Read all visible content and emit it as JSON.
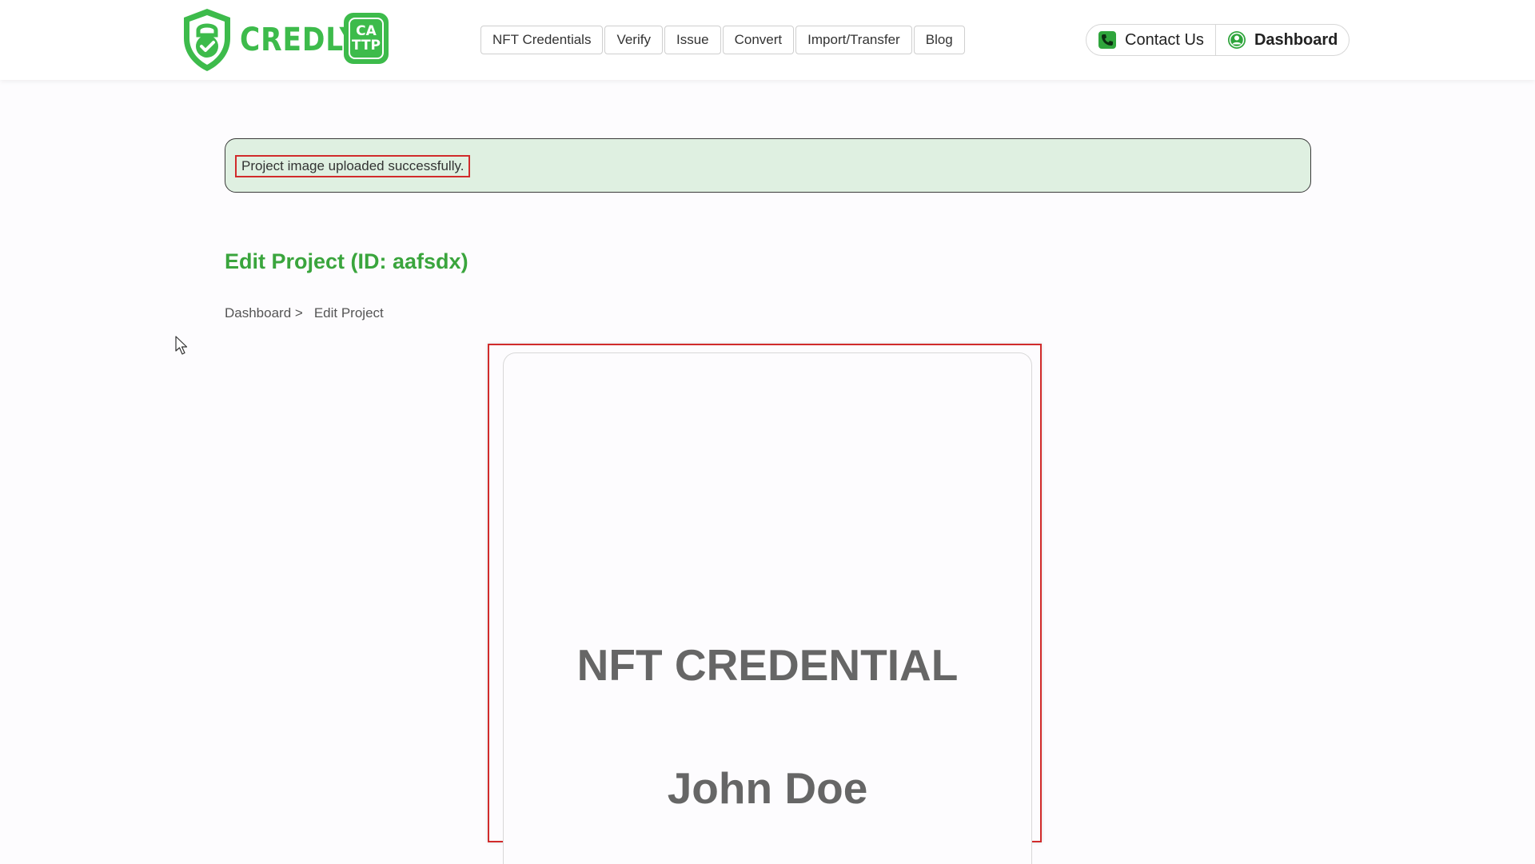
{
  "header": {
    "logo_text": "CREDLY",
    "logo_badge_top": "CA",
    "logo_badge_bottom": "TTP",
    "nav": [
      {
        "label": "NFT Credentials"
      },
      {
        "label": "Verify"
      },
      {
        "label": "Issue"
      },
      {
        "label": "Convert"
      },
      {
        "label": "Import/Transfer"
      },
      {
        "label": "Blog"
      }
    ],
    "contact_label": "Contact Us",
    "dashboard_label": "Dashboard",
    "brand_color": "#3dbb4b"
  },
  "alert": {
    "message": "Project image uploaded successfully."
  },
  "page": {
    "title": "Edit Project (ID: aafsdx)",
    "breadcrumb": {
      "parent": "Dashboard >",
      "current": "Edit Project"
    }
  },
  "preview": {
    "title": "NFT CREDENTIAL",
    "name": "John Doe"
  },
  "icons": {
    "contact": "phone-icon",
    "dashboard": "user-icon",
    "logo": "shield-check-icon"
  }
}
